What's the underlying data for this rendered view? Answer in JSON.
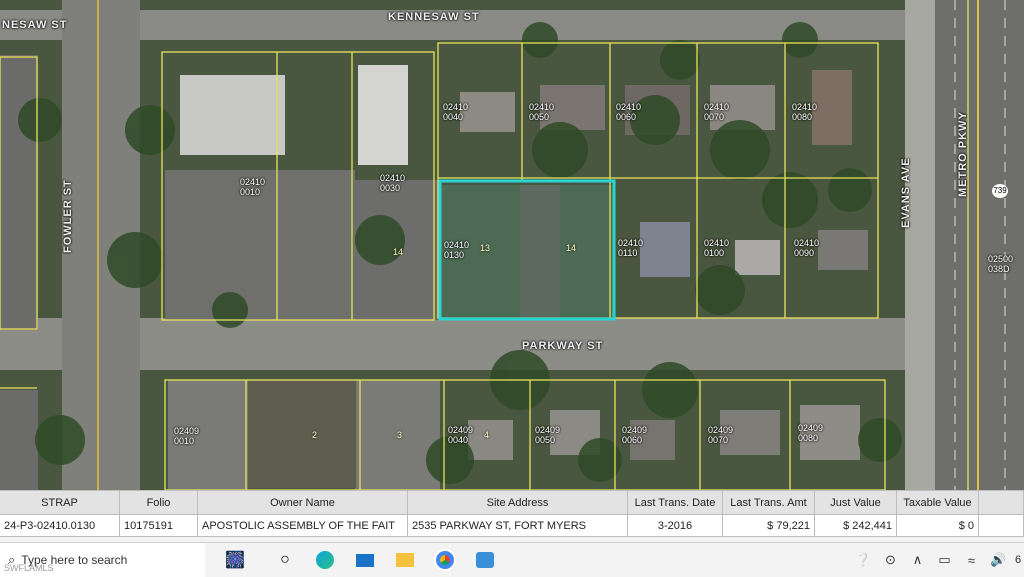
{
  "map": {
    "streets": {
      "kennesaw": "KENNESAW ST",
      "kennesaw_left": "NESAW ST",
      "fowler": "FOWLER ST",
      "parkway": "PARKWAY ST",
      "evans": "EVANS AVE",
      "metro": "METRO PKWY",
      "route": "739"
    },
    "parcels": {
      "p0010_top": "02410\n0010",
      "p0030": "02410\n0030",
      "p0040": "02410\n0040",
      "p0050": "02410\n0050",
      "p0060": "02410\n0060",
      "p0070": "02410\n0070",
      "p0080": "02410\n0080",
      "p0130": "02410\n0130",
      "p0110": "02410\n0110",
      "p0100": "02410\n0100",
      "p0090": "02410\n0090",
      "p02500": "02500\n038D",
      "s0010": "02409\n0010",
      "s0040": "02409\n0040",
      "s0050": "02409\n0050",
      "s0060": "02409\n0060",
      "s0070": "02409\n0070",
      "s0080": "02409\n0080"
    },
    "lots": {
      "l14a": "14",
      "l13": "13",
      "l14b": "14",
      "l2": "2",
      "l3": "3",
      "l4": "4"
    }
  },
  "table": {
    "headers": [
      "STRAP",
      "Folio",
      "Owner Name",
      "Site Address",
      "Last Trans. Date",
      "Last Trans. Amt",
      "Just Value",
      "Taxable Value"
    ],
    "row": {
      "strap": "24-P3-02410.0130",
      "folio": "10175191",
      "owner": "APOSTOLIC ASSEMBLY OF THE FAIT",
      "address": "2535 PARKWAY ST, FORT MYERS",
      "date": "3-2016",
      "amount": "$ 79,221",
      "just_value": "$ 242,441",
      "taxable_value": "$ 0"
    }
  },
  "taskbar": {
    "search_placeholder": "Type here to search",
    "watermark": "SWFLAMLS",
    "page_indicator": "6"
  },
  "colors": {
    "highlight": "#28d5d5",
    "parcel_line": "#e6e25a"
  }
}
